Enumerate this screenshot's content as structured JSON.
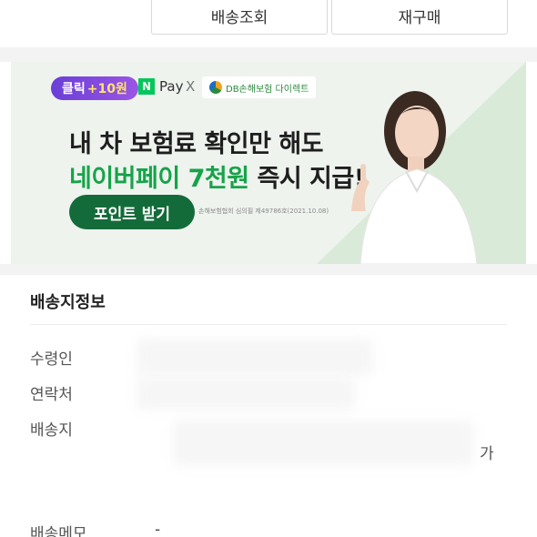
{
  "top_buttons": {
    "track_label": "배송조회",
    "rebuy_label": "재구매"
  },
  "banner": {
    "chip_click": "클릭",
    "chip_reward": "+10원",
    "npay_logo": "N",
    "npay_label": "Pay",
    "times": "X",
    "db_label": "DB손해보험 다이렉트",
    "headline_line1": "내 차 보험료 확인만 해도",
    "headline_line2_highlight": "네이버페이 7천원",
    "headline_line2_rest": " 즉시 지급!",
    "point_button": "포인트 받기",
    "fineprint": "손해보험협회 심의필 제49786호(2021.10.08)"
  },
  "shipping_info": {
    "title": "배송지정보",
    "recipient_label": "수령인",
    "phone_label": "연락처",
    "address_label": "배송지",
    "address_tail": "가",
    "memo_label": "배송메모",
    "memo_value": "-"
  }
}
